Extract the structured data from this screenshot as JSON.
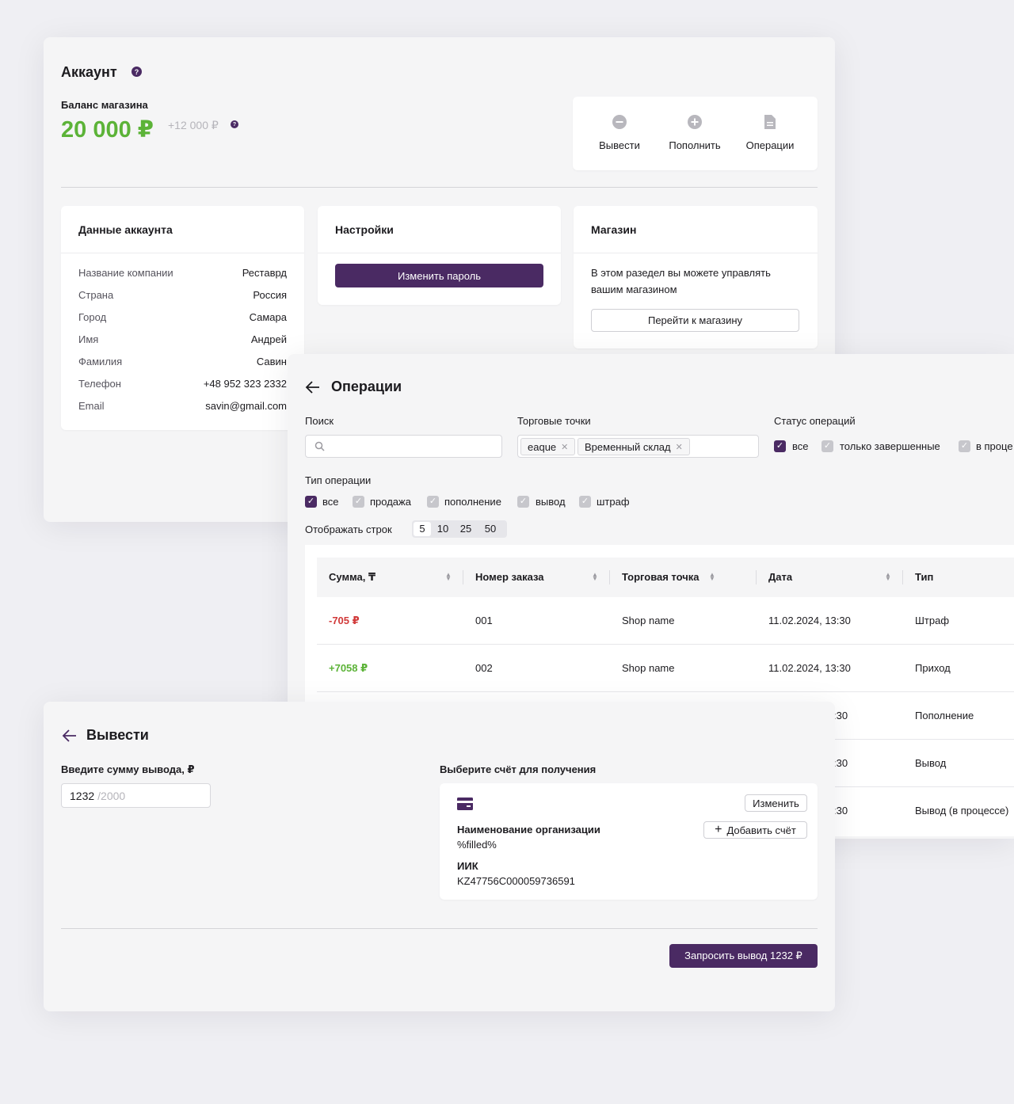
{
  "account": {
    "title": "Аккаунт",
    "balance_label": "Баланс магазина",
    "balance_value": "20 000 ₽",
    "balance_pending": "+12 000 ₽",
    "help_mark": "?",
    "actions": [
      {
        "label": "Вывести",
        "icon": "minus-circle-icon"
      },
      {
        "label": "Пополнить",
        "icon": "plus-circle-icon"
      },
      {
        "label": "Операции",
        "icon": "document-icon"
      }
    ],
    "data_card": {
      "title": "Данные аккаунта",
      "rows": [
        {
          "key": "Название компании",
          "value": "Реставрд"
        },
        {
          "key": "Страна",
          "value": "Россия"
        },
        {
          "key": "Город",
          "value": "Самара"
        },
        {
          "key": "Имя",
          "value": "Андрей"
        },
        {
          "key": "Фамилия",
          "value": "Савин"
        },
        {
          "key": "Телефон",
          "value": "+48 952 323 2332"
        },
        {
          "key": "Email",
          "value": "savin@gmail.com"
        }
      ]
    },
    "settings_card": {
      "title": "Настройки",
      "button": "Изменить пароль"
    },
    "shop_card": {
      "title": "Магазин",
      "text_line1": "В этом разедел вы можете управлять",
      "text_line2": "вашим магазином",
      "button": "Перейти к магазину"
    }
  },
  "operations": {
    "title": "Операции",
    "search_label": "Поиск",
    "points_label": "Торговые точки",
    "points_tags": [
      "eaque",
      "Временный склад"
    ],
    "status_label": "Статус операций",
    "status_options": [
      {
        "label": "все",
        "checked": true
      },
      {
        "label": "только завершенные",
        "checked": false
      },
      {
        "label": "в проце",
        "checked": false
      }
    ],
    "type_label": "Тип операции",
    "type_options": [
      {
        "label": "все",
        "checked": true
      },
      {
        "label": "продажа",
        "checked": false
      },
      {
        "label": "пополнение",
        "checked": false
      },
      {
        "label": "вывод",
        "checked": false
      },
      {
        "label": "штраф",
        "checked": false
      }
    ],
    "rows_label": "Отображать строк",
    "rows_options": [
      "5",
      "10",
      "25",
      "50"
    ],
    "rows_selected": "5",
    "columns": [
      "Сумма, ₸",
      "Номер заказа",
      "Торговая точка",
      "Дата",
      "Тип"
    ],
    "rows": [
      {
        "amount": "-705 ₽",
        "order": "001",
        "shop": "Shop name",
        "date": "11.02.2024, 13:30",
        "type": "Штраф"
      },
      {
        "amount": "+7058 ₽",
        "order": "002",
        "shop": "Shop name",
        "date": "11.02.2024, 13:30",
        "type": "Приход"
      }
    ],
    "hidden_rows": [
      {
        "date_tail": ":30",
        "type": "Пополнение"
      },
      {
        "date_tail": ":30",
        "type": "Вывод"
      },
      {
        "date_tail": ":30",
        "type": "Вывод (в процессе)"
      }
    ]
  },
  "withdraw": {
    "title": "Вывести",
    "amount_label": "Введите сумму вывода, ₽",
    "amount_value": "1232",
    "amount_limit": "/2000",
    "account_label": "Выберите счёт для получения",
    "org_label": "Наименование организации",
    "org_value": "%filled%",
    "iik_label": "ИИК",
    "iik_value": "KZ47756C000059736591",
    "change_button": "Изменить",
    "add_button": "Добавить счёт",
    "submit_button": "Запросить вывод 1232 ₽"
  },
  "colors": {
    "accent": "#4a2a63",
    "positive": "#5cb338",
    "negative": "#d13a3a"
  }
}
